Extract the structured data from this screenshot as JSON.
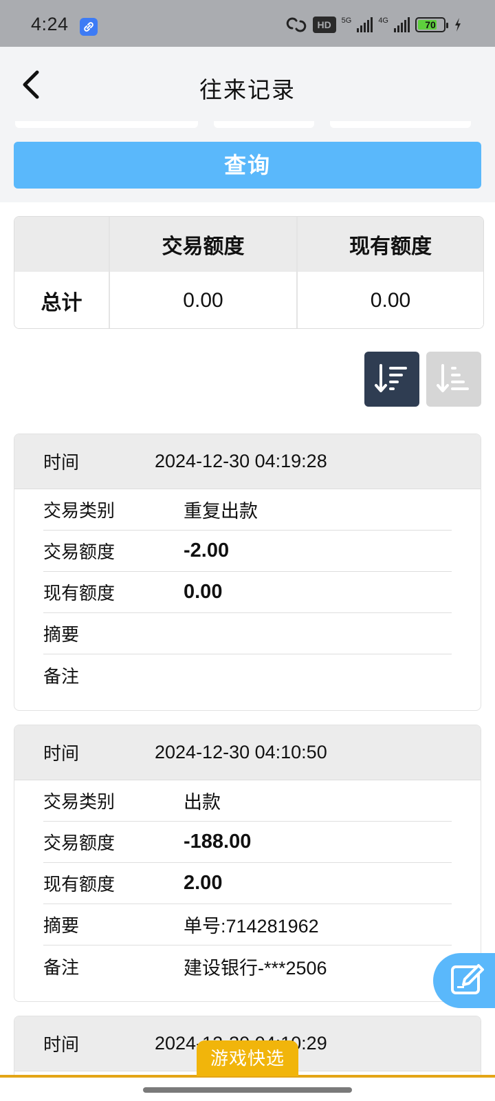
{
  "status_bar": {
    "time": "4:24",
    "hd_label": "HD",
    "net_5g": "5G",
    "net_4g": "4G",
    "battery": "70",
    "icons": [
      "link-app-icon",
      "hotspot-icon",
      "hd-voice-icon",
      "signal-5g-icon",
      "signal-4g-icon",
      "battery-icon",
      "charging-icon"
    ]
  },
  "header": {
    "title": "往来记录",
    "back_icon": "chevron-left-icon"
  },
  "search": {
    "query_label": "查询"
  },
  "summary": {
    "col_trade": "交易额度",
    "col_current": "现有额度",
    "row_label": "总计",
    "trade_total": "0.00",
    "current_total": "0.00"
  },
  "sort": {
    "desc_icon": "sort-descending-icon",
    "asc_icon": "sort-ascending-icon",
    "active": "desc"
  },
  "labels": {
    "time": "时间",
    "type": "交易类别",
    "amount": "交易额度",
    "balance": "现有额度",
    "summary": "摘要",
    "note": "备注"
  },
  "records": [
    {
      "time": "2024-12-30 04:19:28",
      "type": "重复出款",
      "amount": "-2.00",
      "balance": "0.00",
      "summary": "",
      "note": ""
    },
    {
      "time": "2024-12-30 04:10:50",
      "type": "出款",
      "amount": "-188.00",
      "balance": "2.00",
      "summary": "单号:714281962",
      "note": "建设银行-***2506"
    },
    {
      "time": "2024-12-30 04:10:29"
    }
  ],
  "floating": {
    "edit_icon": "edit-note-icon",
    "game_quick_select": "游戏快选"
  },
  "colors": {
    "accent_blue": "#5ab8fb",
    "sort_active": "#2f3d52",
    "game_tab": "#f1b50b"
  }
}
